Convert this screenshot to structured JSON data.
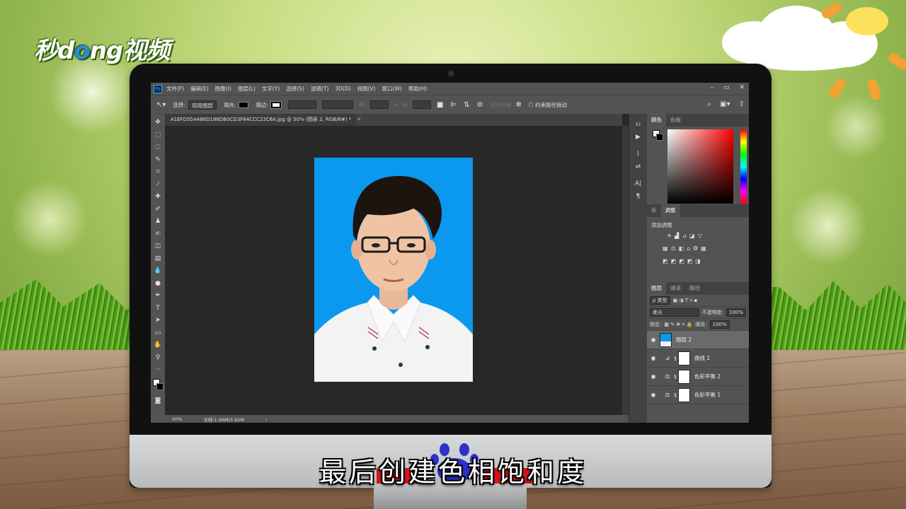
{
  "branding": {
    "logo_text": "秒dong视频"
  },
  "app": {
    "menu": [
      "文件(F)",
      "编辑(E)",
      "图像(I)",
      "图层(L)",
      "文字(Y)",
      "选择(S)",
      "滤镜(T)",
      "3D(D)",
      "视图(V)",
      "窗口(W)",
      "帮助(H)"
    ],
    "window_controls": [
      "–",
      "▭",
      "✕"
    ],
    "options": {
      "select_label": "选择:",
      "select_value": "现用图层",
      "fill_label": "填充:",
      "stroke_label": "描边:",
      "w_label": "W:",
      "h_label": "H:",
      "align_edges": "对齐边缘",
      "constrain_path": "约束路径拖动"
    },
    "document_tab": {
      "title": "A1EFD55A486D188DB0CD3F64CCC22C6A.jpg @ 50% (图层 2, RGB/8#) *",
      "close": "✕"
    },
    "status": {
      "zoom": "50%",
      "doc_size": "文档:1.96M/3.92M",
      "arrow": "›"
    },
    "panels": {
      "color_tabs": [
        "颜色",
        "色板"
      ],
      "adjust_tabs": [
        "库",
        "调整"
      ],
      "adjust_title": "添加调整",
      "layers_tabs": [
        "图层",
        "通道",
        "路径"
      ],
      "kind_label": "ρ 类型",
      "blend_mode": "柔光",
      "opacity_label": "不透明度:",
      "opacity_value": "100%",
      "lock_label": "锁定:",
      "fill_label": "填充:",
      "fill_value": "100%",
      "layers": [
        {
          "name": "图层 2",
          "type": "pixel",
          "selected": true
        },
        {
          "name": "曲线 1",
          "type": "curves",
          "selected": false
        },
        {
          "name": "色彩平衡 2",
          "type": "color-balance",
          "selected": false
        },
        {
          "name": "色彩平衡 1",
          "type": "color-balance",
          "selected": false
        }
      ]
    }
  },
  "subtitle": "最后创建色相饱和度",
  "colors": {
    "photo_bg": "#0b98ef",
    "ps_panel": "#535353",
    "ps_dark": "#282828"
  }
}
